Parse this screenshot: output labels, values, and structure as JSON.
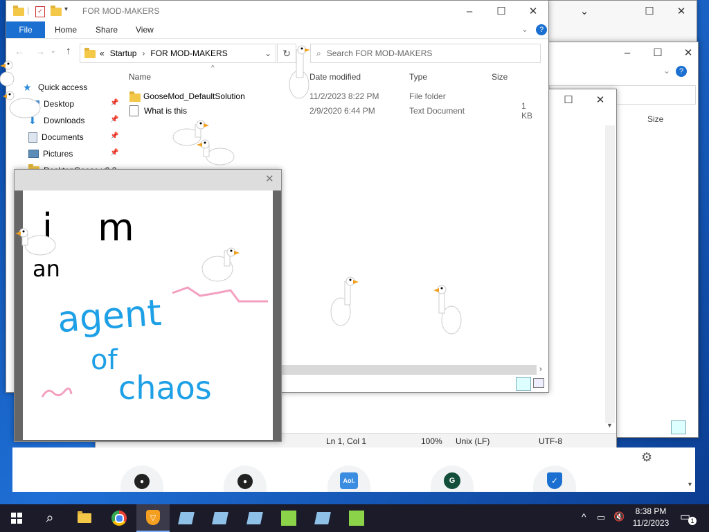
{
  "explorer_main": {
    "title": "FOR MOD-MAKERS",
    "ribbon_tabs": [
      "File",
      "Home",
      "Share",
      "View"
    ],
    "breadcrumb": {
      "sep": "«",
      "parent": "Startup",
      "current": "FOR MOD-MAKERS"
    },
    "search_placeholder": "Search FOR MOD-MAKERS",
    "nav": {
      "quick_access": "Quick access",
      "items": [
        "Desktop",
        "Downloads",
        "Documents",
        "Pictures",
        "DesktopGoose v0.3"
      ]
    },
    "columns": [
      "Name",
      "Date modified",
      "Type",
      "Size"
    ],
    "files": [
      {
        "name": "GooseMod_DefaultSolution",
        "date": "11/2/2023 8:22 PM",
        "type": "File folder",
        "size": ""
      },
      {
        "name": "What is this",
        "date": "2/9/2020 6:44 PM",
        "type": "Text Document",
        "size": "1 KB"
      }
    ]
  },
  "explorer_back": {
    "size_header": "Size"
  },
  "notepad": {
    "status": {
      "position": "Ln 1, Col 1",
      "zoom": "100%",
      "line_ending": "Unix (LF)",
      "encoding": "UTF-8"
    }
  },
  "drawing": {
    "line1": "i m",
    "line2": "an",
    "line3": "agent",
    "line4": "of",
    "line5": "chaos"
  },
  "browser_shortcuts": [
    "GitHub",
    "GitHub",
    "Aol.",
    "G",
    ""
  ],
  "taskbar": {
    "time": "8:38 PM",
    "date": "11/2/2023",
    "notification_count": "1"
  },
  "colors": {
    "accent": "#1a6fd1",
    "taskbar": "#1b1b2a",
    "desktop": "#0b4aa8",
    "marker_black": "#000000",
    "marker_blue": "#1ea0e6",
    "marker_pink": "#f3a0c0"
  }
}
